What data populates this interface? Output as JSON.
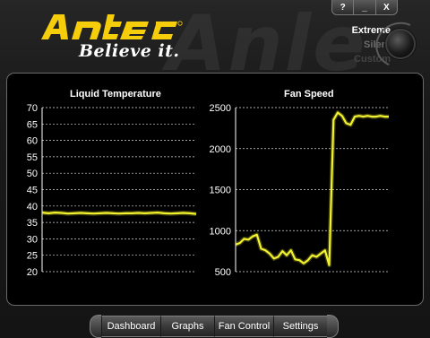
{
  "app": {
    "logo_text": "Antec",
    "tagline": "Believe it.",
    "watermark_text": "Anle"
  },
  "window_controls": {
    "help": "?",
    "minimize": "_",
    "close": "X"
  },
  "profiles": {
    "items": [
      "Extreme",
      "Silent",
      "Custom"
    ],
    "selected": "Extreme"
  },
  "colors": {
    "brand_yellow": "#f5cd0a",
    "series_yellow": "#f2f22e",
    "panel_bg": "#000000"
  },
  "charts": {
    "liquid_temperature": {
      "title": "Liquid Temperature"
    },
    "fan_speed": {
      "title": "Fan Speed"
    }
  },
  "chart_data": [
    {
      "type": "line",
      "title": "Liquid Temperature",
      "ylim": [
        20,
        70
      ],
      "yticks": [
        70,
        65,
        60,
        55,
        50,
        45,
        40,
        35,
        30,
        25,
        20
      ],
      "grid": true,
      "series": [
        {
          "values": [
            38,
            37.8,
            38,
            37.9,
            37.7,
            37.8,
            37.9,
            37.8,
            37.7,
            37.8,
            37.9,
            37.8,
            37.7,
            37.8,
            37.8,
            37.9,
            37.8,
            37.9,
            38,
            37.8,
            37.7,
            37.8,
            37.9,
            37.8,
            37.6
          ]
        }
      ]
    },
    {
      "type": "line",
      "title": "Fan Speed",
      "ylim": [
        500,
        2500
      ],
      "yticks": [
        2500,
        2000,
        1500,
        1000,
        500
      ],
      "grid": true,
      "series": [
        {
          "values": [
            830,
            850,
            900,
            890,
            930,
            950,
            780,
            760,
            720,
            660,
            680,
            750,
            700,
            760,
            650,
            640,
            600,
            640,
            700,
            680,
            720,
            760,
            580,
            2350,
            2440,
            2400,
            2310,
            2290,
            2390,
            2400,
            2390,
            2400,
            2390,
            2390,
            2400,
            2390,
            2390
          ]
        }
      ]
    }
  ],
  "nav": {
    "tabs": [
      "Dashboard",
      "Graphs",
      "Fan Control",
      "Settings"
    ]
  }
}
